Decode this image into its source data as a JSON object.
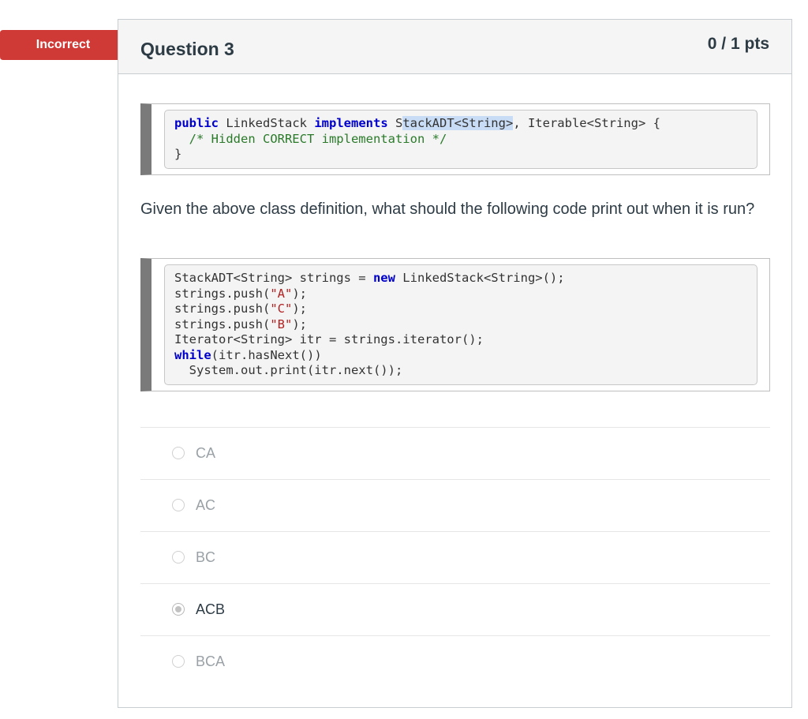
{
  "status_flag": {
    "label": "Incorrect",
    "color": "#d03a36"
  },
  "question": {
    "title": "Question 3",
    "points": "0 / 1 pts",
    "prompt": "Given the above class definition, what should the following code print out when it is run?"
  },
  "code1": {
    "l1_kw1": "public",
    "l1_t1": " LinkedStack ",
    "l1_kw2": "implements",
    "l1_t2": " S",
    "l1_hl": "tackADT<String>",
    "l1_t3": ", Iterable<String> {",
    "l2": "  /* Hidden CORRECT implementation */",
    "l3": "}"
  },
  "code2": {
    "l1_t1": "StackADT<String> strings = ",
    "l1_kw": "new",
    "l1_t2": " LinkedStack<String>();",
    "l2_t1": "strings.push(",
    "l2_s": "\"A\"",
    "l2_t2": ");",
    "l3_t1": "strings.push(",
    "l3_s": "\"C\"",
    "l3_t2": ");",
    "l4_t1": "strings.push(",
    "l4_s": "\"B\"",
    "l4_t2": ");",
    "l5": "Iterator<String> itr = strings.iterator();",
    "l6_kw": "while",
    "l6_t": "(itr.hasNext())",
    "l7": "  System.out.print(itr.next());"
  },
  "answers": [
    {
      "label": "CA",
      "selected": false
    },
    {
      "label": "AC",
      "selected": false
    },
    {
      "label": "BC",
      "selected": false
    },
    {
      "label": "ACB",
      "selected": true
    },
    {
      "label": "BCA",
      "selected": false
    }
  ]
}
